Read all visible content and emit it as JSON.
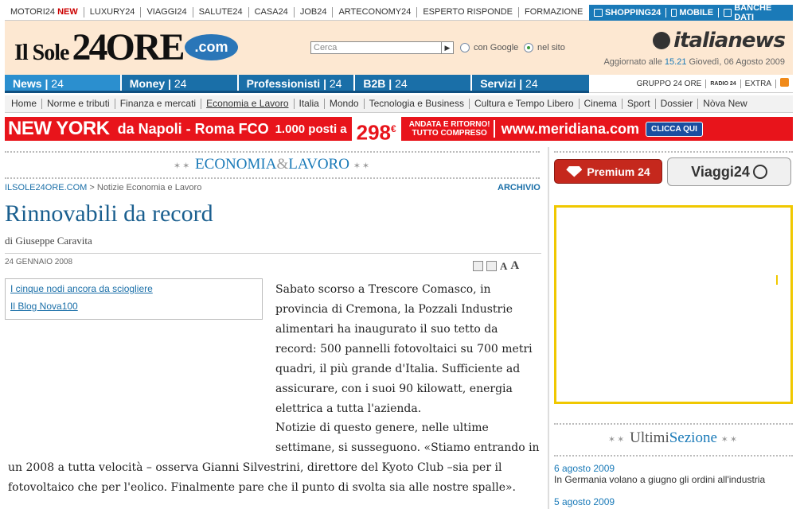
{
  "topnav": {
    "items": [
      "MOTORI24",
      "LUXURY24",
      "VIAGGI24",
      "SALUTE24",
      "CASA24",
      "JOB24",
      "ARTECONOMY24",
      "ESPERTO RISPONDE",
      "FORMAZIONE"
    ],
    "new_badge": "NEW",
    "right": [
      "SHOPPING24",
      "MOBILE",
      "BANCHE DATI"
    ]
  },
  "header": {
    "logo_il": "Il Sole",
    "logo_num": "24",
    "logo_ore": "ORE",
    "logo_com": ".com",
    "search_placeholder": "Cerca",
    "radio_google": "con Google",
    "radio_sito": "nel sito",
    "italianews": "italianews",
    "updated_prefix": "Aggiornato alle",
    "updated_time": "15.21",
    "updated_date": "Giovedì, 06 Agosto 2009"
  },
  "bluenav": [
    {
      "label": "News",
      "sub": "24"
    },
    {
      "label": "Money",
      "sub": "24"
    },
    {
      "label": "Professionisti",
      "sub": "24"
    },
    {
      "label": "B2B",
      "sub": "24"
    },
    {
      "label": "Servizi",
      "sub": "24"
    }
  ],
  "grupponav": {
    "gruppo": "GRUPPO 24 ORE",
    "radio": "RADIO 24",
    "extra": "EXTRA"
  },
  "secnav": [
    "Home",
    "Norme e tributi",
    "Finanza e mercati",
    "Economia e Lavoro",
    "Italia",
    "Mondo",
    "Tecnologia e Business",
    "Cultura e Tempo Libero",
    "Cinema",
    "Sport",
    "Dossier",
    "Nòva New"
  ],
  "banner": {
    "ny": "NEW YORK",
    "route": "da Napoli - Roma FCO",
    "posti": "1.000 posti a",
    "price": "298",
    "currency": "€",
    "ar1": "ANDATA E RITORNO!",
    "ar2": "TUTTO COMPRESO",
    "url": "www.meridiana.com",
    "clicca": "CLICCA QUI"
  },
  "section": {
    "name1": "ECONOMIA",
    "amp": "&",
    "name2": "LAVORO"
  },
  "breadcrumb": {
    "home": "ILSOLE24ORE.COM",
    "sep": " > ",
    "page": "Notizie Economia e Lavoro"
  },
  "archivio": "ARCHIVIO",
  "article": {
    "title": "Rinnovabili da record",
    "byline": "di Giuseppe Caravita",
    "date": "24 GENNAIO 2008",
    "related": [
      "I cinque nodi ancora da sciogliere",
      "Il Blog Nova100"
    ],
    "para1": "Sabato scorso a Trescore Comasco, in provincia di Cremona, la Pozzali Industrie alimentari ha inaugurato il suo tetto da record: 500 pannelli fotovoltaici su 700 metri quadri, il più grande d'Italia. Sufficiente ad assicurare, con i suoi 90 kilowatt, energia elettrica a tutta l'azienda.",
    "para2a": "Notizie di questo genere, nelle ultime settimane, si susseguono. «Stiamo entrando in",
    "para2b": "un 2008 a tutta velocità – osserva Gianni Silvestrini, direttore del Kyoto Club –sia per il fotovoltaico che per l'eolico. Finalmente pare che il punto di svolta sia alle nostre spalle»."
  },
  "right": {
    "premium": "Premium 24",
    "viaggi": "Viaggi24",
    "ultimi1": "Ultimi",
    "ultimi2": "Sezione",
    "news": [
      {
        "date": "6 agosto 2009",
        "text": "In Germania volano a giugno gli ordini all'industria"
      },
      {
        "date": "5 agosto 2009",
        "text": ""
      }
    ]
  },
  "colors": {
    "accent": "#1a7ab8",
    "nav": "#1a6fa8",
    "banner": "#e8141b",
    "header_bg": "#fde8d2"
  }
}
